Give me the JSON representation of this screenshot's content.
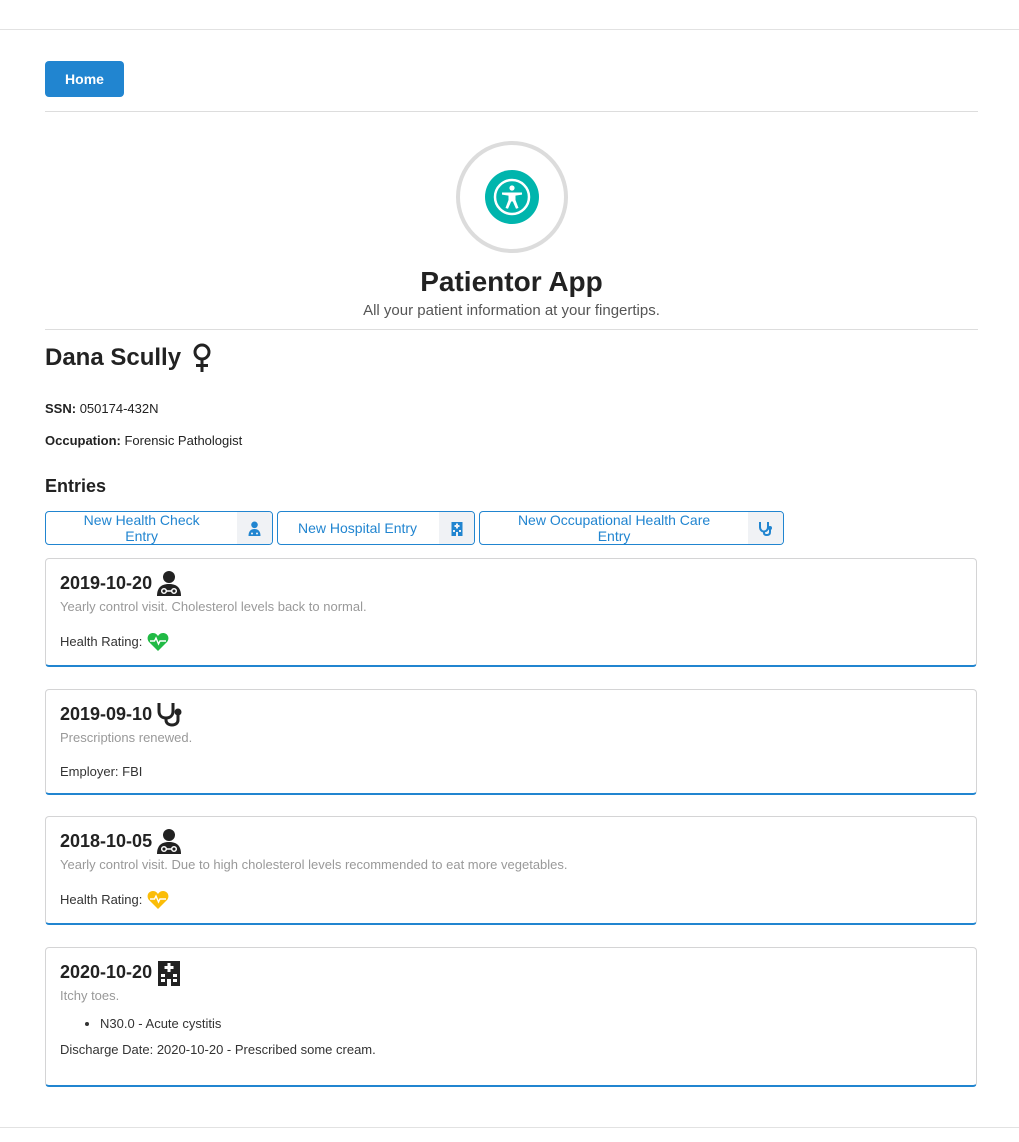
{
  "nav": {
    "home_label": "Home"
  },
  "header": {
    "app_title": "Patientor App",
    "subtitle": "All your patient information at your fingertips.",
    "logo_icon": "universal-access-icon",
    "logo_color": "#00b5ad"
  },
  "patient": {
    "name": "Dana Scully",
    "gender_icon": "venus-icon",
    "ssn_label": "SSN:",
    "ssn": "050174-432N",
    "occupation_label": "Occupation:",
    "occupation": "Forensic Pathologist"
  },
  "entries_title": "Entries",
  "buttons": [
    {
      "label": "New Health Check Entry",
      "icon": "user-doctor-icon"
    },
    {
      "label": "New Hospital Entry",
      "icon": "hospital-icon"
    },
    {
      "label": "New Occupational Health Care Entry",
      "icon": "stethoscope-icon"
    }
  ],
  "entries": [
    {
      "date": "2019-10-20",
      "icon": "user-doctor-icon",
      "description": "Yearly control visit. Cholesterol levels back to normal.",
      "extra_label": "Health Rating:",
      "rating_color": "#21ba45"
    },
    {
      "date": "2019-09-10",
      "icon": "stethoscope-icon",
      "description": "Prescriptions renewed.",
      "extra_label": "Employer: FBI"
    },
    {
      "date": "2018-10-05",
      "icon": "user-doctor-icon",
      "description": "Yearly control visit. Due to high cholesterol levels recommended to eat more vegetables.",
      "extra_label": "Health Rating:",
      "rating_color": "#fbbd08"
    },
    {
      "date": "2020-10-20",
      "icon": "hospital-icon",
      "description": "Itchy toes.",
      "codes": [
        "N30.0 - Acute cystitis"
      ],
      "extra_label": "Discharge Date: 2020-10-20 - Prescribed some cream."
    }
  ],
  "colors": {
    "primary": "#2185d0",
    "card_border": "#d4d4d5"
  }
}
